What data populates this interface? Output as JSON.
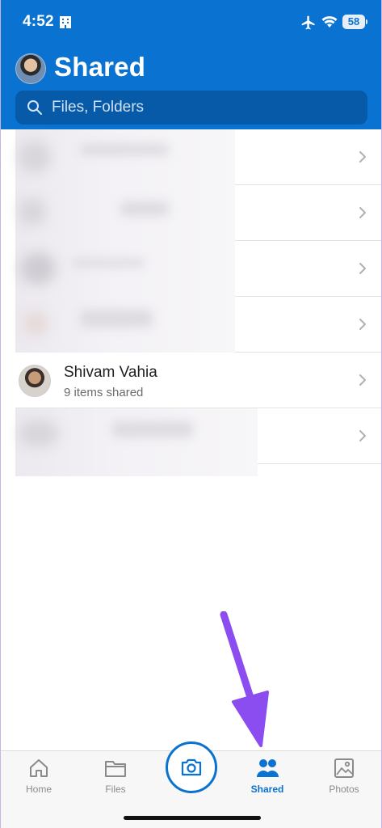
{
  "status_bar": {
    "time": "4:52",
    "battery": "58"
  },
  "header": {
    "title": "Shared"
  },
  "search": {
    "placeholder": "Files, Folders"
  },
  "list": {
    "person": {
      "name": "Shivam Vahia",
      "subtitle": "9 items shared"
    }
  },
  "nav": {
    "home": "Home",
    "files": "Files",
    "shared": "Shared",
    "photos": "Photos",
    "active": "shared"
  },
  "colors": {
    "brand": "#0a72d1",
    "search_bg": "#075aa7",
    "annotation_arrow": "#8b4df0"
  }
}
